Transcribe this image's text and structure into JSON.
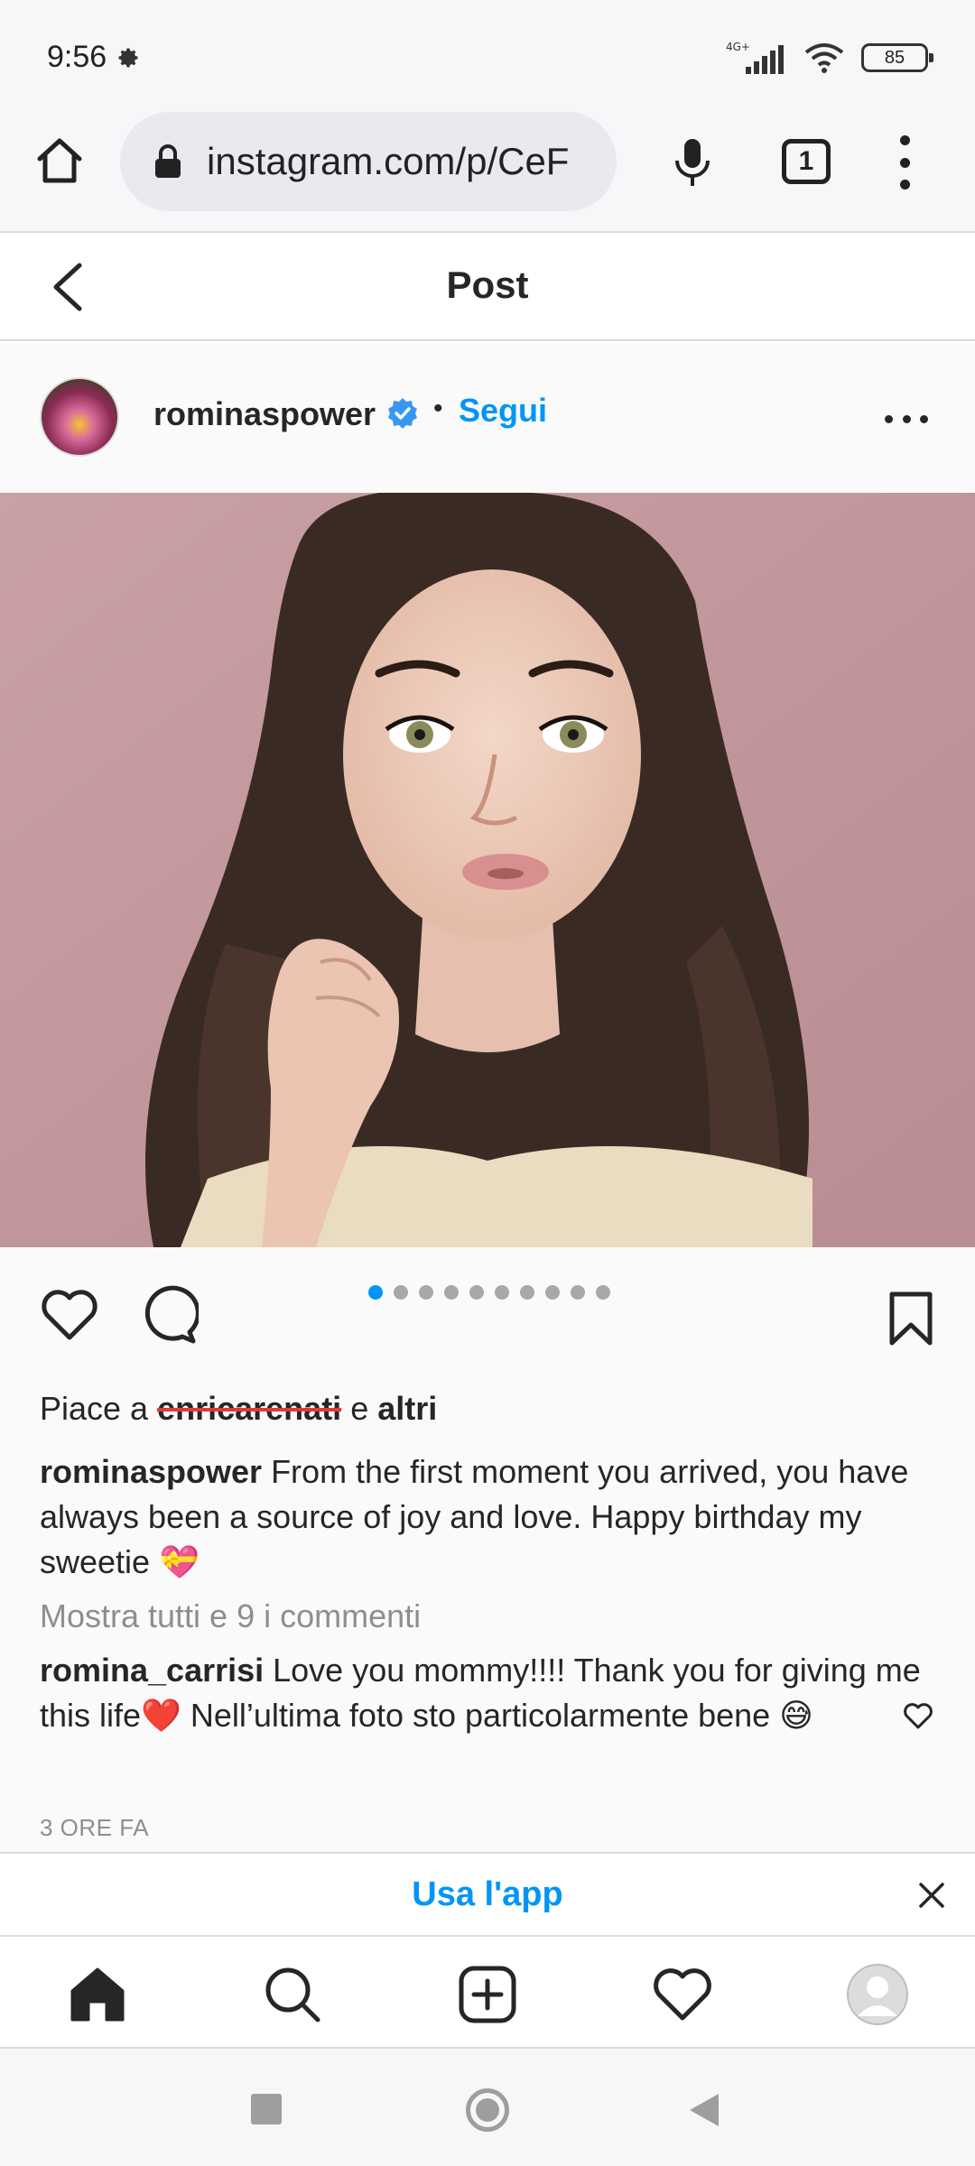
{
  "status_bar": {
    "time": "9:56",
    "network": "4G+",
    "battery": "85",
    "icons": [
      "settings-icon",
      "signal-icon",
      "wifi-icon",
      "battery-icon"
    ]
  },
  "browser": {
    "url": "instagram.com/p/CeF",
    "tab_count": "1",
    "icons": [
      "home-icon",
      "lock-icon",
      "mic-icon",
      "tabs-icon",
      "overflow-menu-icon"
    ]
  },
  "header": {
    "title": "Post"
  },
  "post": {
    "author": "rominaspower",
    "separator": "•",
    "follow_label": "Segui",
    "carousel": {
      "total": 10,
      "active_index": 0
    },
    "likes": {
      "prefix": "Piace a ",
      "struck_name": "enricarenati",
      "joiner": " e ",
      "others": "altri"
    },
    "caption": {
      "author": "rominaspower",
      "text": " From the first moment you arrived, you have always been a source of joy and love. Happy birthday my sweetie 💝"
    },
    "show_comments": "Mostra tutti e 9 i commenti",
    "top_comment": {
      "author": "romina_carrisi",
      "text": " Love you mommy!!!! Thank you for giving me this life❤️ Nell’ultima foto sto particolarmente bene 😅"
    },
    "timestamp": "3 ORE FA"
  },
  "app_banner": {
    "label": "Usa l'app"
  },
  "colors": {
    "link_blue": "#0095f6",
    "text_dark": "#262626",
    "text_muted": "#8e8e8e",
    "verified_blue": "#3897f0",
    "photo_background": "#c79da1"
  }
}
